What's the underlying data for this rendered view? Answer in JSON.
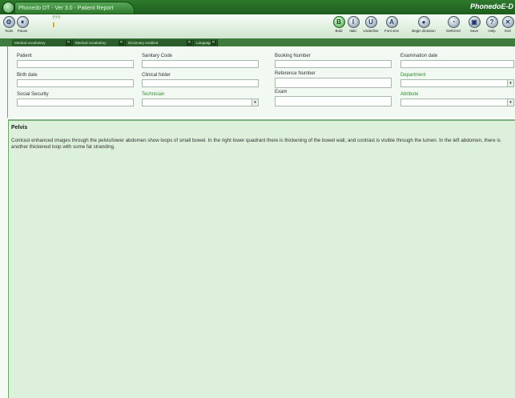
{
  "window": {
    "title": "Phonedo DT - Ver 3.0 - Patient Report",
    "brand": "PhonedoE-D"
  },
  "toolbar": {
    "left": [
      {
        "label": "Tools",
        "glyph": "⚙",
        "icon": "tools-icon"
      },
      {
        "label": "Pause",
        "glyph": "⏸",
        "icon": "pause-icon"
      }
    ],
    "right": [
      {
        "label": "Bold",
        "glyph": "B",
        "icon": "bold-icon",
        "active": true
      },
      {
        "label": "Italic",
        "glyph": "I",
        "icon": "italic-icon"
      },
      {
        "label": "Underline",
        "glyph": "U",
        "icon": "underline-icon"
      },
      {
        "label": "Font size",
        "glyph": "A",
        "icon": "font-size-icon"
      },
      {
        "label": "Begin dictation",
        "glyph": "●",
        "icon": "dictation-icon"
      },
      {
        "label": "Deferred",
        "glyph": "◔",
        "icon": "deferred-icon"
      },
      {
        "label": "Save",
        "glyph": "▣",
        "icon": "save-icon"
      },
      {
        "label": "Help",
        "glyph": "?",
        "icon": "help-icon"
      },
      {
        "label": "Exit",
        "glyph": "✕",
        "icon": "exit-icon"
      }
    ],
    "status_mark": "???"
  },
  "field_tabs": [
    {
      "label": "Medical vocabulary"
    },
    {
      "label": "Medical vocabulary"
    },
    {
      "label": "Dictionary enabled"
    },
    {
      "label": "Language"
    }
  ],
  "form": {
    "patient": {
      "label": "Patient",
      "value": ""
    },
    "sanitary_code": {
      "label": "Sanitary Code",
      "value": ""
    },
    "booking_number": {
      "label": "Booking Number",
      "value": ""
    },
    "examination_date": {
      "label": "Examination date",
      "value": ""
    },
    "birth_date": {
      "label": "Birth date",
      "value": ""
    },
    "clinical_folder": {
      "label": "Clinical folder",
      "value": ""
    },
    "reference_number": {
      "label": "Reference Number",
      "value": ""
    },
    "department": {
      "label": "Department",
      "value": ""
    },
    "social_security": {
      "label": "Social Security",
      "value": ""
    },
    "technician": {
      "label": "Technician",
      "value": ""
    },
    "exam": {
      "label": "Exam",
      "value": ""
    },
    "attribute": {
      "label": "Attribute",
      "value": ""
    }
  },
  "report": {
    "title": "Pelvis",
    "text": "Contrast enhanced images through the pelvis/lower abdomen show loops of small bowel. In the right lower quadrant there is thickening of the bowel wall, and contrast is visible through the lumen. In the left abdomen, there is another thickened loop with some fat stranding."
  },
  "colors": {
    "accent": "#2f8a2f",
    "report_bg": "#dcf0dc",
    "titlebar": "#1d5c1d"
  }
}
